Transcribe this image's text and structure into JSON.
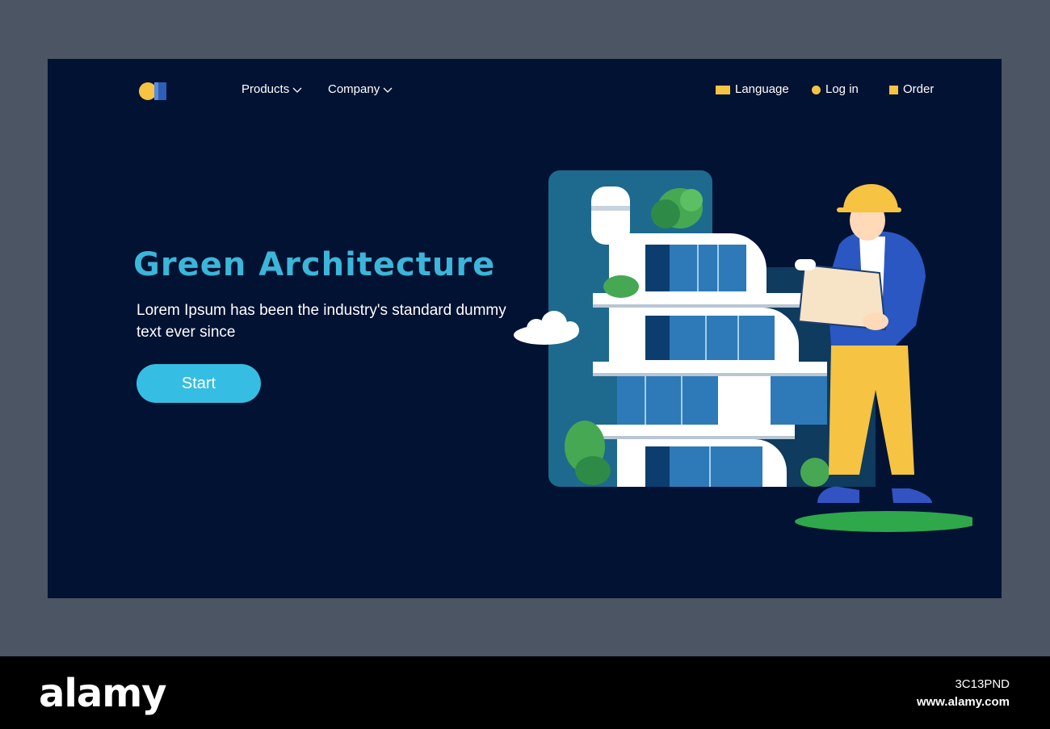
{
  "nav": {
    "products_label": "Products",
    "company_label": "Company",
    "language_label": "Language",
    "login_label": "Log in",
    "order_label": "Order"
  },
  "hero": {
    "title": "Green Architecture",
    "subtitle": "Lorem Ipsum has been the industry's standard dummy text ever since",
    "start_label": "Start"
  },
  "watermark": {
    "brand": "alamy",
    "image_id": "3C13PND",
    "url": "www.alamy.com"
  },
  "colors": {
    "page_bg": "#011233",
    "outer_bg": "#4b5563",
    "accent": "#36bde3",
    "title": "#3bb6d9",
    "marker": "#f6c342"
  },
  "icons": [
    "logo-icon",
    "chevron-down-icon",
    "flag-icon",
    "dot-icon",
    "square-icon"
  ]
}
